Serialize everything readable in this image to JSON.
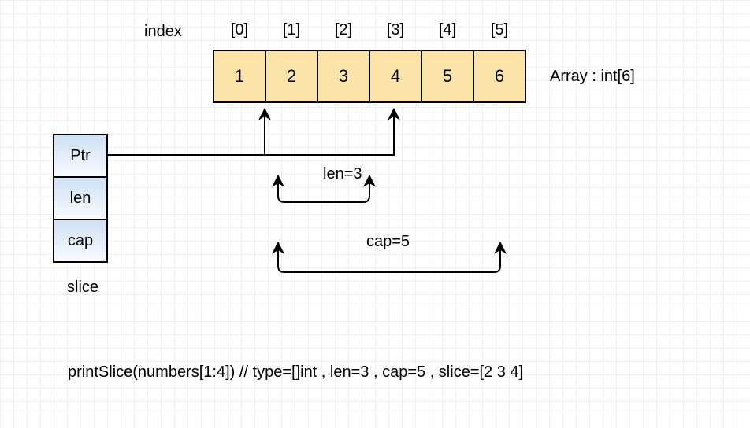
{
  "labels": {
    "index": "index",
    "array": "Array : int[6]",
    "slice": "slice",
    "len_ann": "len=3",
    "cap_ann": "cap=5"
  },
  "indices": [
    "[0]",
    "[1]",
    "[2]",
    "[3]",
    "[4]",
    "[5]"
  ],
  "array_values": [
    "1",
    "2",
    "3",
    "4",
    "5",
    "6"
  ],
  "slice_struct": {
    "ptr": "Ptr",
    "len": "len",
    "cap": "cap"
  },
  "code": "printSlice(numbers[1:4]) // type=[]int , len=3 , cap=5 , slice=[2 3 4]",
  "chart_data": {
    "type": "table",
    "array": {
      "name": "Array",
      "element_type": "int",
      "length": 6,
      "indices": [
        0,
        1,
        2,
        3,
        4,
        5
      ],
      "values": [
        1,
        2,
        3,
        4,
        5,
        6
      ]
    },
    "slice": {
      "expr": "numbers[1:4]",
      "ptr_index": 1,
      "len": 3,
      "cap": 5,
      "len_range_indices": [
        1,
        3
      ],
      "cap_range_indices": [
        1,
        5
      ],
      "values": [
        2,
        3,
        4
      ]
    }
  }
}
